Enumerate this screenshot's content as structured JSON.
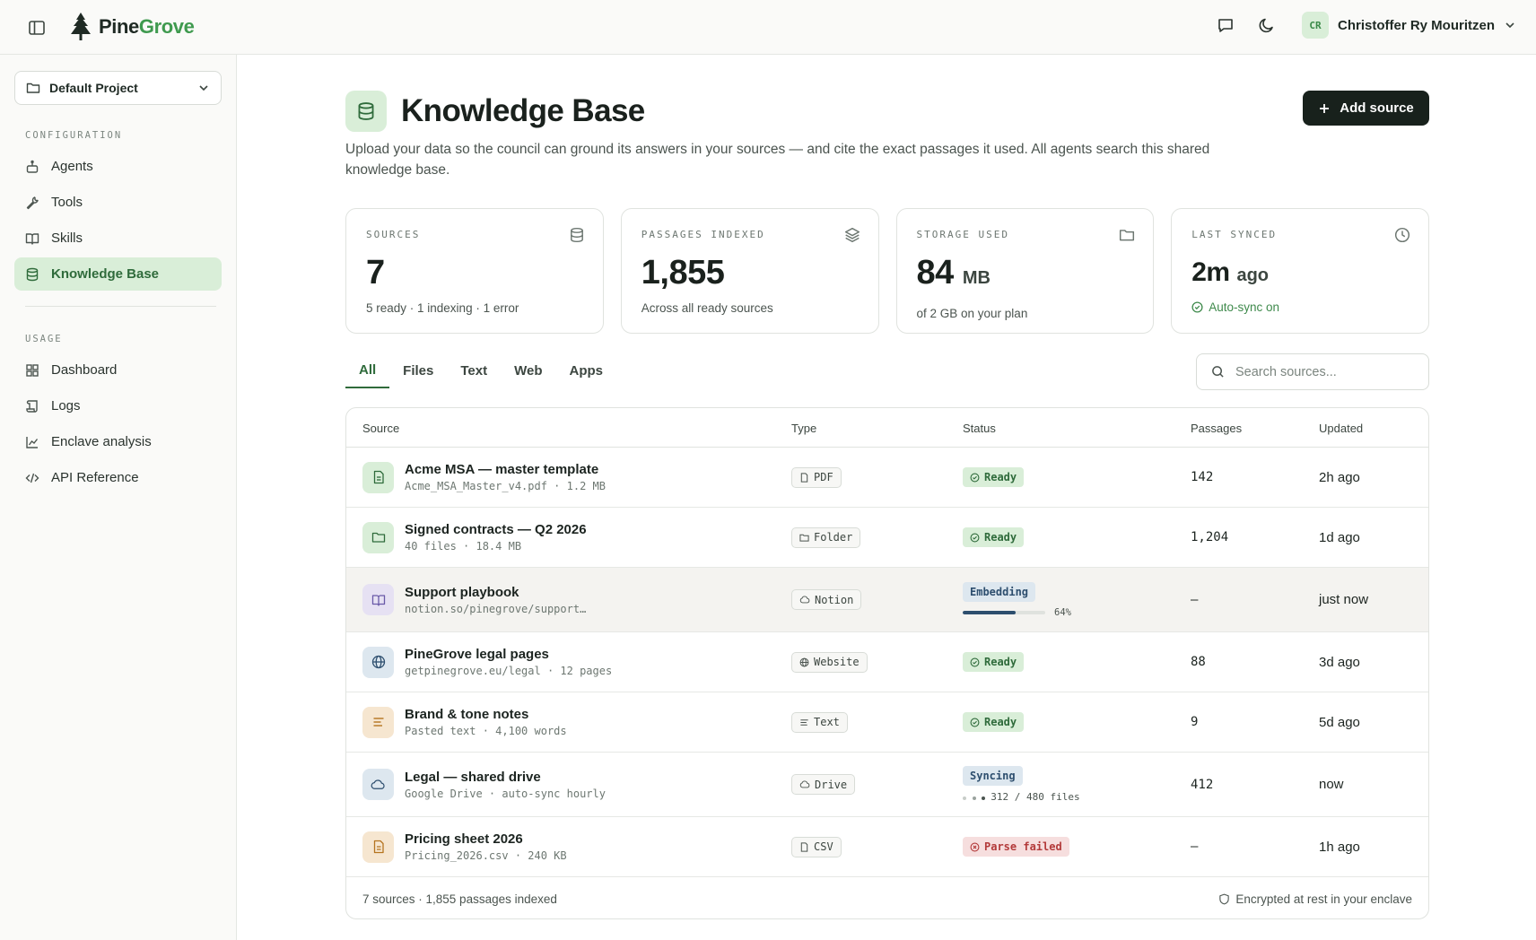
{
  "brand": {
    "name_part1": "Pine",
    "name_part2": "Grove",
    "accent": "#3f9a4f"
  },
  "header": {
    "user_initials": "CR",
    "user_name": "Christoffer Ry Mouritzen"
  },
  "sidebar": {
    "project": "Default Project",
    "config_title": "CONFIGURATION",
    "config_items": [
      {
        "label": "Agents",
        "icon": "robot-icon"
      },
      {
        "label": "Tools",
        "icon": "wrench-icon"
      },
      {
        "label": "Skills",
        "icon": "book-icon"
      },
      {
        "label": "Knowledge Base",
        "icon": "database-icon",
        "active": true
      }
    ],
    "usage_title": "USAGE",
    "usage_items": [
      {
        "label": "Dashboard",
        "icon": "grid-icon"
      },
      {
        "label": "Logs",
        "icon": "scroll-icon"
      },
      {
        "label": "Enclave analysis",
        "icon": "chart-icon"
      },
      {
        "label": "API Reference",
        "icon": "code-icon"
      }
    ]
  },
  "page": {
    "title": "Knowledge Base",
    "add_button": "Add source",
    "subtitle": "Upload your data so the council can ground its answers in your sources — and cite the exact passages it used. All agents search this shared knowledge base."
  },
  "stats": [
    {
      "label": "SOURCES",
      "value": "7",
      "unit": "",
      "sub": "5 ready · 1 indexing · 1 error",
      "icon": "database-icon"
    },
    {
      "label": "PASSAGES INDEXED",
      "value": "1,855",
      "unit": "",
      "sub": "Across all ready sources",
      "icon": "layers-icon"
    },
    {
      "label": "STORAGE USED",
      "value": "84",
      "unit": "MB",
      "sub": "of 2 GB on your plan",
      "icon": "folder-icon"
    },
    {
      "label": "LAST SYNCED",
      "value": "2m",
      "unit": "ago",
      "sub": "Auto-sync on",
      "icon": "clock-icon"
    }
  ],
  "tabs": [
    "All",
    "Files",
    "Text",
    "Web",
    "Apps"
  ],
  "search": {
    "placeholder": "Search sources..."
  },
  "table": {
    "columns": [
      "Source",
      "Type",
      "Status",
      "Passages",
      "Updated"
    ],
    "rows": [
      {
        "name": "Acme MSA — master template",
        "meta": "Acme_MSA_Master_v4.pdf · 1.2 MB",
        "type": "PDF",
        "status": "Ready",
        "passages": "142",
        "updated": "2h ago"
      },
      {
        "name": "Signed contracts — Q2 2026",
        "meta": "40 files · 18.4 MB",
        "type": "Folder",
        "status": "Ready",
        "passages": "1,204",
        "updated": "1d ago"
      },
      {
        "name": "Support playbook",
        "meta": "notion.so/pinegrove/support…",
        "type": "Notion",
        "status": "Embedding",
        "progress": 64,
        "progress_text": "64%",
        "passages": "—",
        "updated": "just now"
      },
      {
        "name": "PineGrove legal pages",
        "meta": "getpinegrove.eu/legal · 12 pages",
        "type": "Website",
        "status": "Ready",
        "passages": "88",
        "updated": "3d ago"
      },
      {
        "name": "Brand & tone notes",
        "meta": "Pasted text · 4,100 words",
        "type": "Text",
        "status": "Ready",
        "passages": "9",
        "updated": "5d ago"
      },
      {
        "name": "Legal — shared drive",
        "meta": "Google Drive · auto-sync hourly",
        "type": "Drive",
        "status": "Syncing",
        "sync_text": "312 / 480 files",
        "passages": "412",
        "updated": "now"
      },
      {
        "name": "Pricing sheet 2026",
        "meta": "Pricing_2026.csv · 240 KB",
        "type": "CSV",
        "status": "Parse failed",
        "passages": "—",
        "updated": "1h ago"
      }
    ],
    "footer_left": "7 sources · 1,855 passages indexed",
    "footer_right": "Encrypted at rest in your enclave"
  }
}
